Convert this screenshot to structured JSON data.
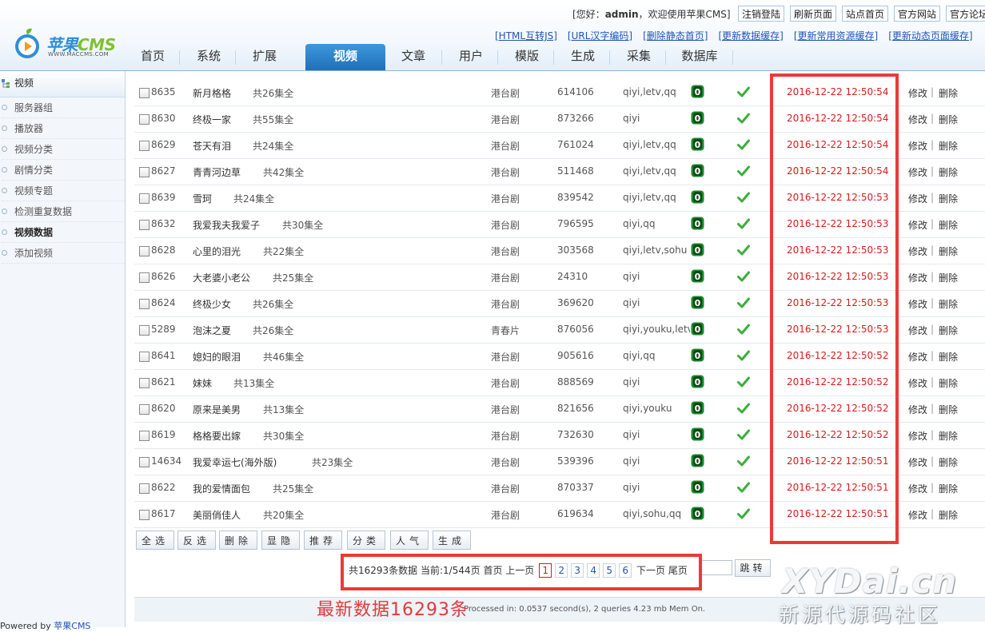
{
  "header": {
    "logo": {
      "brand_cn": "苹果",
      "brand_en": "CMS",
      "url": "WWW.MACCMS.COM"
    },
    "welcome": {
      "prefix": "[您好：",
      "user": "admin",
      "suffix": "，欢迎使用苹果CMS]"
    },
    "top_buttons": [
      "注销登陆",
      "刷新页面",
      "站点首页",
      "官方网站",
      "官方论坛"
    ],
    "cache_links": [
      "[HTML互转JS]",
      "[URL汉字编码]",
      "[删除静态首页]",
      "[更新数据缓存]",
      "[更新常用资源缓存]",
      "[更新动态页面缓存]"
    ],
    "nav": [
      "首页",
      "系统",
      "扩展",
      "视频",
      "文章",
      "用户",
      "模版",
      "生成",
      "采集",
      "数据库"
    ],
    "nav_active": "视频"
  },
  "sidebar": {
    "title": "视频",
    "items": [
      "服务器组",
      "播放器",
      "视频分类",
      "剧情分类",
      "视频专题",
      "检测重复数据",
      "视频数据",
      "添加视频"
    ],
    "current": "视频数据",
    "powered": {
      "prefix": "Powered by ",
      "link": "苹果CMS"
    }
  },
  "video_list": {
    "rows": [
      {
        "id": "8635",
        "name": "新月格格",
        "serial": "共26集全",
        "type": "港台剧",
        "hits": "614106",
        "from": "qiyi,letv,qq",
        "time": "2016-12-22 12:50:54"
      },
      {
        "id": "8630",
        "name": "终极一家",
        "serial": "共55集全",
        "type": "港台剧",
        "hits": "873266",
        "from": "qiyi",
        "time": "2016-12-22 12:50:54"
      },
      {
        "id": "8629",
        "name": "苍天有泪",
        "serial": "共24集全",
        "type": "港台剧",
        "hits": "761024",
        "from": "qiyi,letv,qq",
        "time": "2016-12-22 12:50:54"
      },
      {
        "id": "8627",
        "name": "青青河边草",
        "serial": "共42集全",
        "type": "港台剧",
        "hits": "511468",
        "from": "qiyi,letv,qq",
        "time": "2016-12-22 12:50:54"
      },
      {
        "id": "8639",
        "name": "雪珂",
        "serial": "共24集全",
        "type": "港台剧",
        "hits": "839542",
        "from": "qiyi,letv,qq",
        "time": "2016-12-22 12:50:53"
      },
      {
        "id": "8632",
        "name": "我爱我夫我爱子",
        "serial": "共30集全",
        "type": "港台剧",
        "hits": "796595",
        "from": "qiyi,qq",
        "time": "2016-12-22 12:50:53"
      },
      {
        "id": "8628",
        "name": "心里的泪光",
        "serial": "共22集全",
        "type": "港台剧",
        "hits": "303568",
        "from": "qiyi,letv,sohu",
        "time": "2016-12-22 12:50:53"
      },
      {
        "id": "8626",
        "name": "大老婆小老公",
        "serial": "共25集全",
        "type": "港台剧",
        "hits": "24310",
        "from": "qiyi",
        "time": "2016-12-22 12:50:53"
      },
      {
        "id": "8624",
        "name": "终极少女",
        "serial": "共26集全",
        "type": "港台剧",
        "hits": "369620",
        "from": "qiyi",
        "time": "2016-12-22 12:50:53"
      },
      {
        "id": "5289",
        "name": "泡沫之夏",
        "serial": "共26集全",
        "type": "青春片",
        "hits": "876056",
        "from": "qiyi,youku,letv,",
        "time": "2016-12-22 12:50:53"
      },
      {
        "id": "8641",
        "name": "媳妇的眼泪",
        "serial": "共46集全",
        "type": "港台剧",
        "hits": "905616",
        "from": "qiyi,qq",
        "time": "2016-12-22 12:50:52"
      },
      {
        "id": "8621",
        "name": "妹妹",
        "serial": "共13集全",
        "type": "港台剧",
        "hits": "888569",
        "from": "qiyi",
        "time": "2016-12-22 12:50:52"
      },
      {
        "id": "8620",
        "name": "原来是美男",
        "serial": "共13集全",
        "type": "港台剧",
        "hits": "821656",
        "from": "qiyi,youku",
        "time": "2016-12-22 12:50:52"
      },
      {
        "id": "8619",
        "name": "格格要出嫁",
        "serial": "共30集全",
        "type": "港台剧",
        "hits": "732630",
        "from": "qiyi",
        "time": "2016-12-22 12:50:52"
      },
      {
        "id": "14634",
        "name": "我爱幸运七(海外版)",
        "serial": "共23集全",
        "type": "港台剧",
        "hits": "539396",
        "from": "qiyi",
        "time": "2016-12-22 12:50:51"
      },
      {
        "id": "8622",
        "name": "我的爱情面包",
        "serial": "共25集全",
        "type": "港台剧",
        "hits": "870337",
        "from": "qiyi",
        "time": "2016-12-22 12:50:51"
      },
      {
        "id": "8617",
        "name": "美丽俏佳人",
        "serial": "共20集全",
        "type": "港台剧",
        "hits": "619634",
        "from": "qiyi,sohu,qq",
        "time": "2016-12-22 12:50:51"
      }
    ],
    "edit_label": "修改",
    "sep": "|",
    "delete_label": "删除",
    "level_glyph": "0"
  },
  "actions": [
    "全选",
    "反选",
    "删除",
    "显隐",
    "推荐",
    "分类",
    "人气",
    "生成"
  ],
  "pager": {
    "summary": "共16293条数据 当前:1/544页",
    "first": "首页",
    "prev": "上一页",
    "pages": [
      "1",
      "2",
      "3",
      "4",
      "5",
      "6"
    ],
    "current": "1",
    "next": "下一页",
    "last": "尾页",
    "jump_label": "跳转"
  },
  "footer": {
    "processed": "Processed in: 0.0537 second(s), 2 queries 4.23 mb Mem On."
  },
  "annotation": {
    "note": "最新数据16293条"
  },
  "watermark": {
    "line1": "XYDai.cn",
    "line2": "新源代源码社区"
  },
  "colors": {
    "accent_blue": "#1f6fb8",
    "time_red": "#d81b1b",
    "highlight_red": "#ea3a3a",
    "level_green": "#1a8a2a",
    "status_green": "#3cae3c"
  }
}
